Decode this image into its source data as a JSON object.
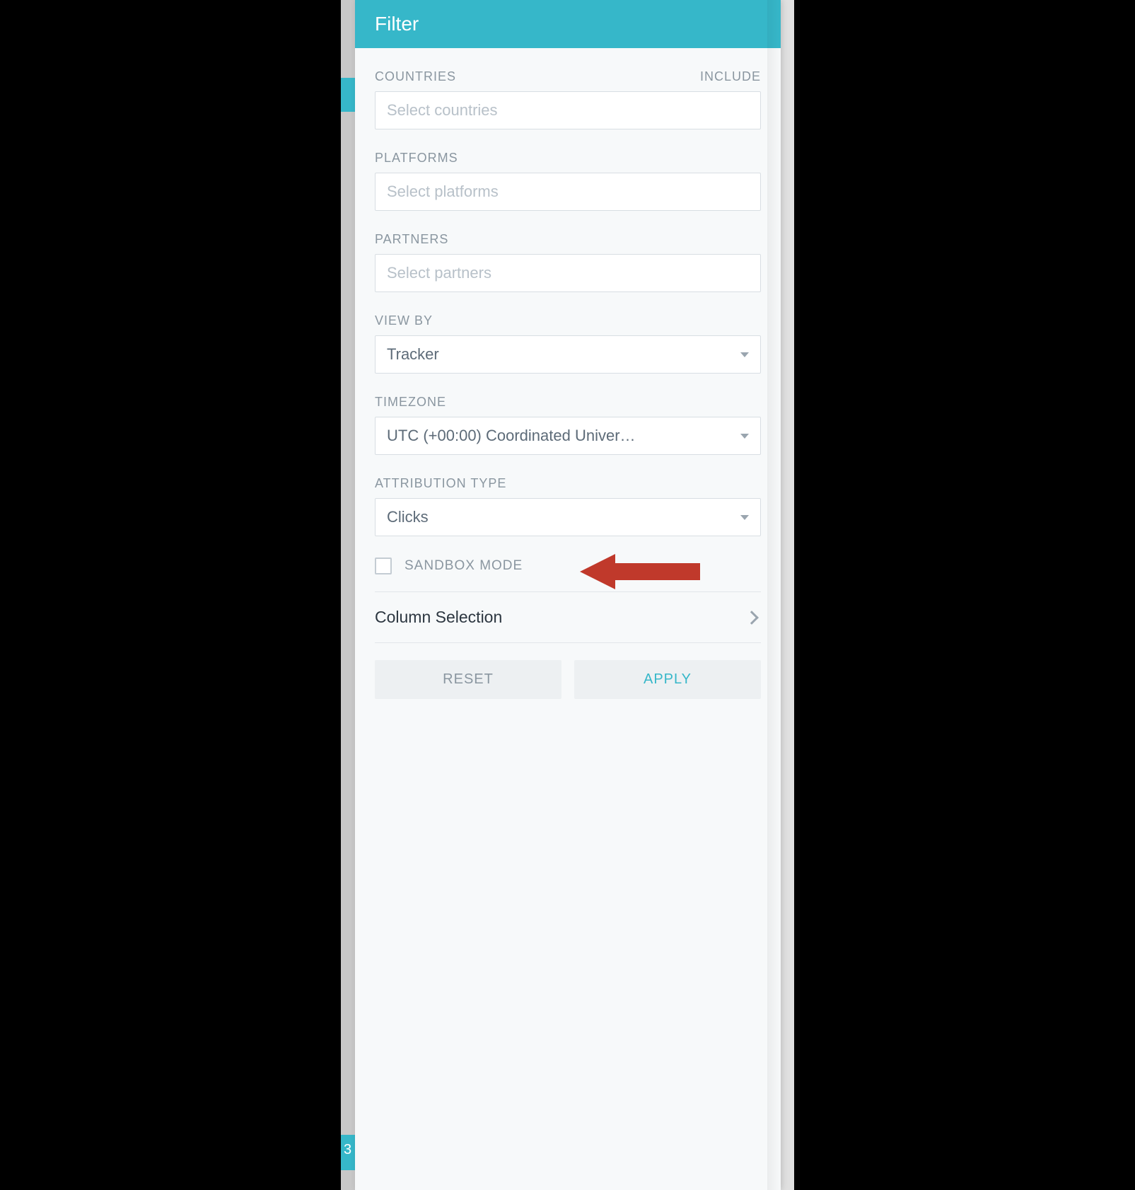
{
  "header": {
    "title": "Filter"
  },
  "countries": {
    "label": "COUNTRIES",
    "mode_label": "INCLUDE",
    "placeholder": "Select countries"
  },
  "platforms": {
    "label": "PLATFORMS",
    "placeholder": "Select platforms"
  },
  "partners": {
    "label": "PARTNERS",
    "placeholder": "Select partners"
  },
  "view_by": {
    "label": "VIEW BY",
    "value": "Tracker"
  },
  "timezone": {
    "label": "TIMEZONE",
    "value": "UTC (+00:00) Coordinated Univer…"
  },
  "attribution_type": {
    "label": "ATTRIBUTION TYPE",
    "value": "Clicks"
  },
  "sandbox": {
    "label": "SANDBOX MODE",
    "checked": false
  },
  "column_selection": {
    "label": "Column Selection"
  },
  "buttons": {
    "reset": "RESET",
    "apply": "APPLY"
  },
  "edge_badge": "3"
}
